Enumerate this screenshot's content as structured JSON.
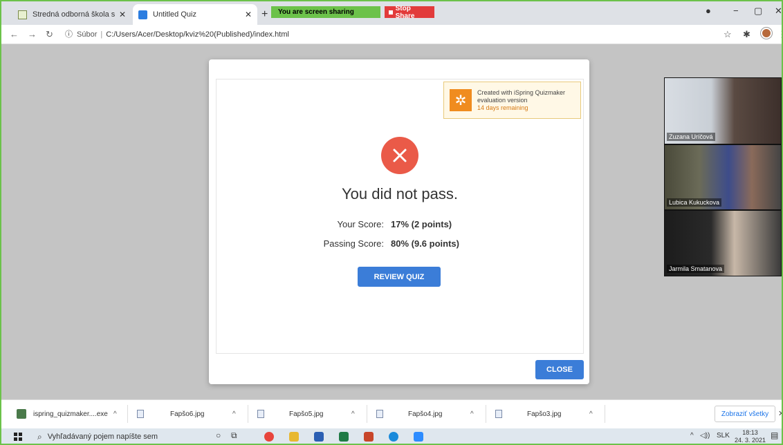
{
  "browser": {
    "tabs": [
      {
        "title": "Stredná odborná škola strojnícka"
      },
      {
        "title": "Untitled Quiz"
      }
    ],
    "share": {
      "sharing_text": "You are screen sharing",
      "stop_label": "Stop Share"
    },
    "address": {
      "security_label": "Súbor",
      "url": "C:/Users/Acer/Desktop/kviz%20(Published)/index.html"
    }
  },
  "ispring": {
    "line1": "Created with iSpring Quizmaker",
    "line2": "evaluation version",
    "line3": "14 days remaining"
  },
  "result": {
    "title": "You did not pass.",
    "your_score_label": "Your Score:",
    "your_score_value": "17% (2 points)",
    "passing_score_label": "Passing Score:",
    "passing_score_value": "80% (9.6 points)",
    "review_label": "REVIEW QUIZ",
    "close_label": "CLOSE"
  },
  "participants": [
    {
      "name": "Zuzana Uríčová"
    },
    {
      "name": "Lubica Kukuckova"
    },
    {
      "name": "Jarmila Smatanova"
    }
  ],
  "downloads": {
    "items": [
      {
        "name": "ispring_quizmaker....exe"
      },
      {
        "name": "Fapšo6.jpg"
      },
      {
        "name": "Fapšo5.jpg"
      },
      {
        "name": "Fapšo4.jpg"
      },
      {
        "name": "Fapšo3.jpg"
      }
    ],
    "show_all_label": "Zobraziť všetky"
  },
  "taskbar": {
    "search_placeholder": "Vyhľadávaný pojem napíšte sem",
    "language": "SLK",
    "time": "18:13",
    "date": "24. 3. 2021"
  },
  "colors": {
    "fail_red": "#ea5a48",
    "button_blue": "#3b7dd8",
    "share_green": "#6cc24a",
    "ispring_orange": "#f08c1f"
  }
}
